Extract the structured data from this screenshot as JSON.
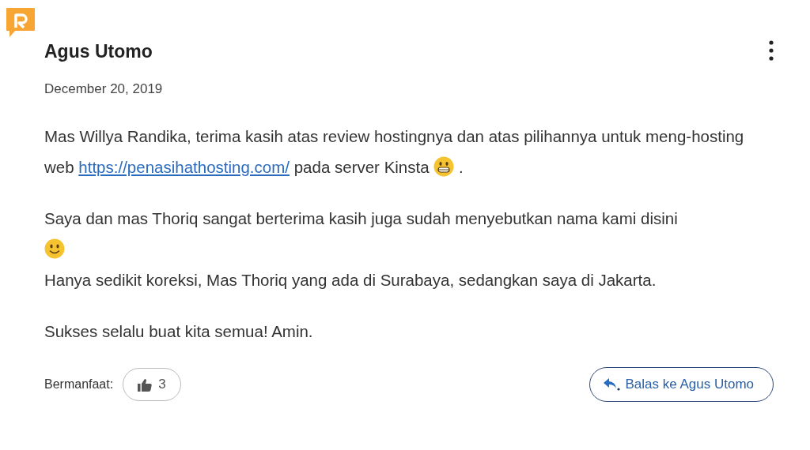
{
  "comment": {
    "author": "Agus Utomo",
    "date": "December 20, 2019",
    "paragraphs": [
      {
        "parts": [
          {
            "kind": "text",
            "text": "Mas Willya Randika, terima kasih atas review hostingnya dan atas pilihannya untuk meng-hosting web "
          },
          {
            "kind": "link",
            "text": "https://penasihathosting.com/"
          },
          {
            "kind": "text",
            "text": " pada server Kinsta "
          },
          {
            "kind": "grin"
          },
          {
            "kind": "text",
            "text": " ."
          }
        ]
      },
      {
        "parts": [
          {
            "kind": "text",
            "text": "Saya dan mas Thoriq sangat berterima kasih juga sudah menyebutkan nama kami disini"
          },
          {
            "kind": "break"
          },
          {
            "kind": "smile"
          },
          {
            "kind": "break"
          },
          {
            "kind": "text",
            "text": "Hanya sedikit koreksi, Mas Thoriq yang ada di Surabaya, sedangkan saya di Jakarta."
          }
        ]
      },
      {
        "parts": [
          {
            "kind": "text",
            "text": "Sukses selalu buat kita semua! Amin."
          }
        ]
      }
    ],
    "helpful_label": "Bermanfaat:",
    "likes": "3",
    "reply_button": "Balas ke Agus Utomo"
  }
}
